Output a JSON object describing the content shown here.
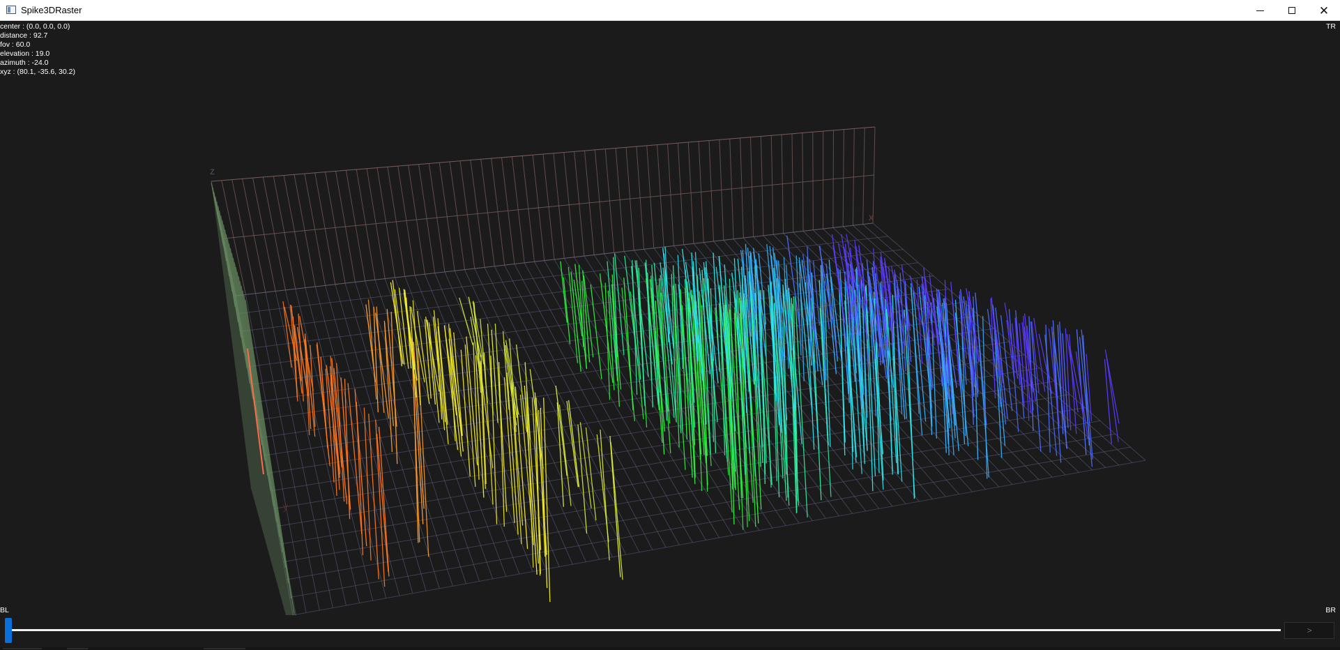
{
  "window": {
    "title": "Spike3DRaster",
    "minimize_glyph": "",
    "maximize_glyph": "",
    "close_glyph": "✕"
  },
  "camera_info": {
    "center": "center : (0.0, 0.0, 0.0)",
    "distance": "distance : 92.7",
    "fov": "fov : 60.0",
    "elevation": "elevation : 19.0",
    "azimuth": "azimuth : -24.0",
    "xyz": "xyz : (80.1, -35.6, 30.2)"
  },
  "corners": {
    "tr": "TR",
    "bl": "BL",
    "br": "BR"
  },
  "axes": {
    "x": "x",
    "y": "y",
    "z": "z"
  },
  "controls": {
    "next_label": ">",
    "slider_position": 0.0
  },
  "colors": {
    "background": "#1b1b1b",
    "grid_back": "#7a5c5c",
    "grid_floor": "#5f5f86",
    "grid_left": "#6a8f63",
    "accent": "#0a6fd8"
  },
  "spike_groups": [
    {
      "color": "#ff7a22"
    },
    {
      "color": "#ffa030"
    },
    {
      "color": "#f3ec2a"
    },
    {
      "color": "#d9ea3a"
    },
    {
      "color": "#31ef42"
    },
    {
      "color": "#2ff0a0"
    },
    {
      "color": "#2fe7ee"
    },
    {
      "color": "#37b2ff"
    },
    {
      "color": "#4d6fff"
    },
    {
      "color": "#5a3bff"
    }
  ]
}
